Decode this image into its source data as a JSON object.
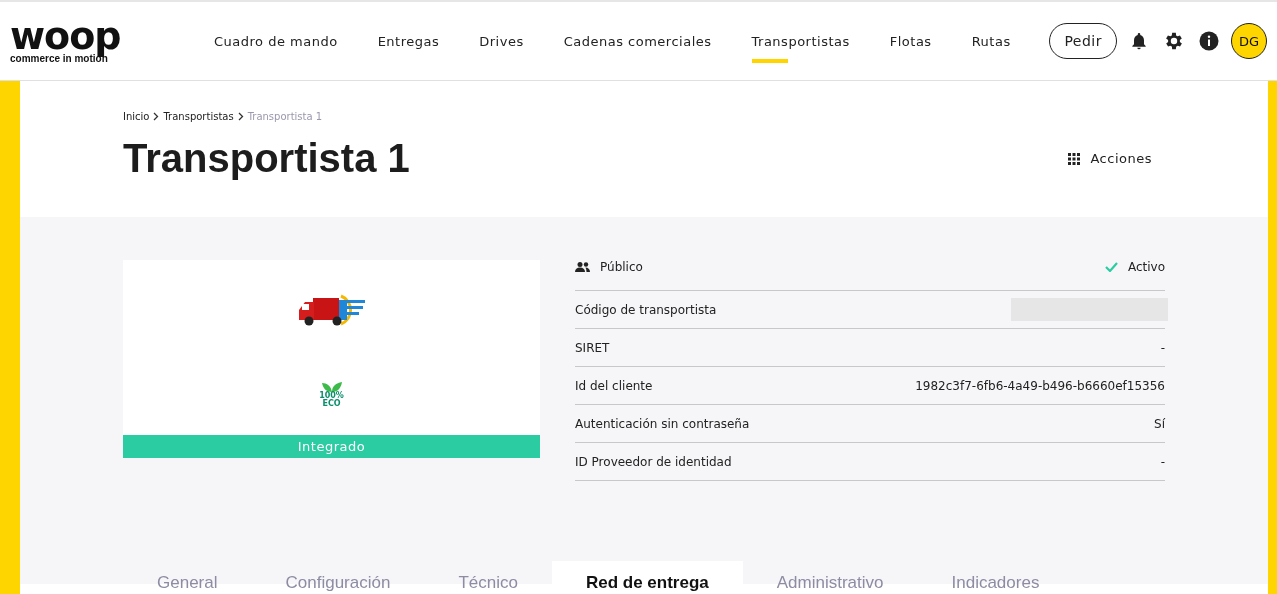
{
  "logo": {
    "wordmark": "woop",
    "tagline": "commerce in motion"
  },
  "nav": [
    {
      "label": "Cuadro de mando",
      "selected": false
    },
    {
      "label": "Entregas",
      "selected": false
    },
    {
      "label": "Drives",
      "selected": false
    },
    {
      "label": "Cadenas comerciales",
      "selected": false
    },
    {
      "label": "Transportistas",
      "selected": true
    },
    {
      "label": "Flotas",
      "selected": false
    },
    {
      "label": "Rutas",
      "selected": false
    }
  ],
  "order_button": "Pedir",
  "avatar": "DG",
  "breadcrumb": [
    {
      "label": "Inicio",
      "current": false
    },
    {
      "label": "Transportistas",
      "current": false
    },
    {
      "label": "Transportista 1",
      "current": true
    }
  ],
  "title": "Transportista 1",
  "actions": "Acciones",
  "card": {
    "eco_badge": {
      "percent": "100%",
      "label": "ECO"
    },
    "status": "Integrado"
  },
  "visibility": "Público",
  "state": {
    "label": "Activo",
    "active": true
  },
  "details": [
    {
      "label": "Código de transportista",
      "kind": "redacted"
    },
    {
      "label": "SIRET",
      "value": "-",
      "kind": "text"
    },
    {
      "label": "Id del cliente",
      "value": "1982c3f7-6fb6-4a49-b496-b6660ef15356",
      "kind": "text"
    },
    {
      "label": "Autenticación sin contraseña",
      "value": "Sí",
      "kind": "text"
    },
    {
      "label": "ID Proveedor de identidad",
      "value": "-",
      "kind": "text"
    }
  ],
  "tabs": [
    {
      "label": "General",
      "selected": false
    },
    {
      "label": "Configuración",
      "selected": false
    },
    {
      "label": "Técnico",
      "selected": false
    },
    {
      "label": "Red de entrega",
      "selected": true
    },
    {
      "label": "Administrativo",
      "selected": false
    },
    {
      "label": "Indicadores",
      "selected": false
    }
  ]
}
